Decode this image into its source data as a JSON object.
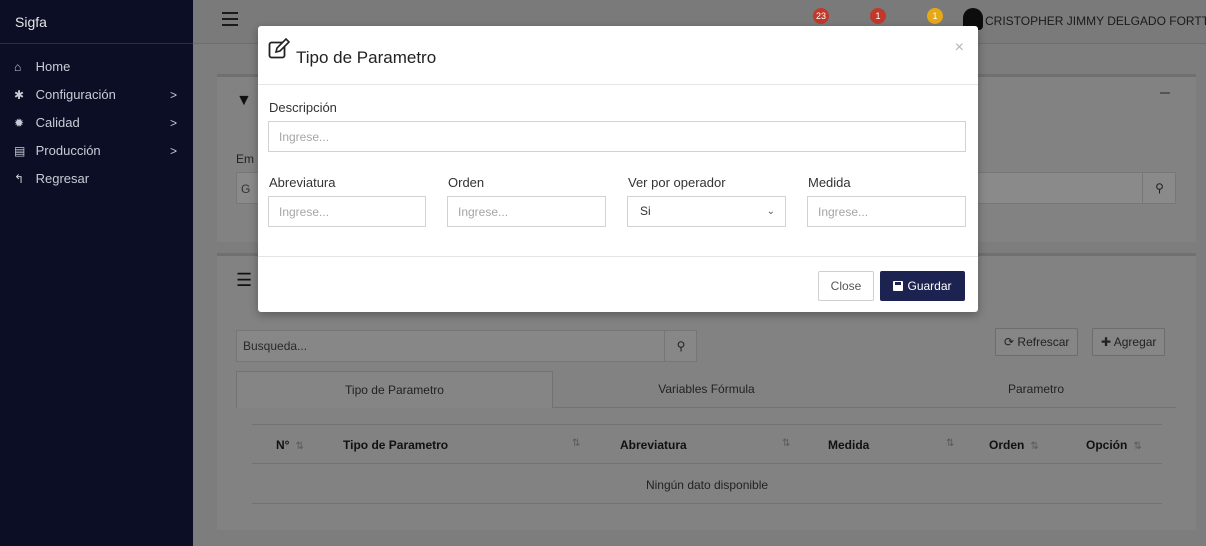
{
  "sidebar": {
    "brand": "Sigfa",
    "items": [
      {
        "label": "Home",
        "icon": "home-icon",
        "glyph": "⌂",
        "submenu": false
      },
      {
        "label": "Configuración",
        "icon": "gear-icon",
        "glyph": "✱",
        "submenu": true
      },
      {
        "label": "Calidad",
        "icon": "gear-icon",
        "glyph": "✹",
        "submenu": true
      },
      {
        "label": "Producción",
        "icon": "document-icon",
        "glyph": "▤",
        "submenu": true
      },
      {
        "label": "Regresar",
        "icon": "reply-icon",
        "glyph": "↰",
        "submenu": false
      }
    ],
    "chevron": ">"
  },
  "topbar": {
    "notifications": [
      {
        "icon": "bell-icon",
        "count": "23",
        "color": "#c0392b"
      },
      {
        "icon": "truck-icon",
        "count": "1",
        "color": "#c0392b"
      },
      {
        "icon": "truck-icon",
        "count": "1",
        "color": "#e6a817"
      }
    ],
    "user_name": "CRISTOPHER JIMMY DELGADO FORTTY"
  },
  "filter_card": {
    "label_partial": "Em",
    "input_partial": "G"
  },
  "list_card": {
    "search_placeholder": "Busqueda...",
    "refresh_label": "Refrescar",
    "add_label": "Agregar",
    "tabs": [
      "Tipo de Parametro",
      "Variables Fórmula",
      "Parametro"
    ],
    "columns": [
      "N°",
      "Tipo de Parametro",
      "Abreviatura",
      "Medida",
      "Orden",
      "Opción"
    ],
    "empty_message": "Ningún dato disponible"
  },
  "modal": {
    "title": "Tipo de Parametro",
    "close_symbol": "×",
    "descripcion_label": "Descripción",
    "descripcion_placeholder": "Ingrese...",
    "abreviatura_label": "Abreviatura",
    "abreviatura_placeholder": "Ingrese...",
    "orden_label": "Orden",
    "orden_placeholder": "Ingrese...",
    "ver_label": "Ver por operador",
    "ver_value": "Si",
    "medida_label": "Medida",
    "medida_placeholder": "Ingrese...",
    "close_button": "Close",
    "save_button": "Guardar"
  },
  "colors": {
    "sidebar_bg": "#0b0e24",
    "primary_button": "#1d2350",
    "badge_red": "#c0392b",
    "badge_yellow": "#e6a817"
  }
}
